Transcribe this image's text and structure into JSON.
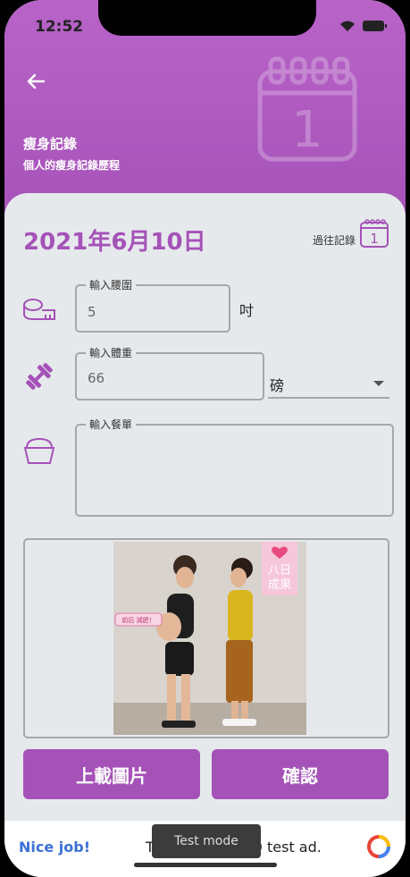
{
  "status": {
    "time": "12:52"
  },
  "header": {
    "title": "瘦身記錄",
    "subtitle": "個人的瘦身記錄歷程",
    "calendar_number": "1"
  },
  "record": {
    "date": "2021年6月10日",
    "history_label": "過往記錄",
    "history_icon_number": "1"
  },
  "waist": {
    "legend": "輸入腰圍",
    "value": "5",
    "unit": "吋"
  },
  "weight": {
    "legend": "輸入體重",
    "value": "66",
    "unit_selected": "磅"
  },
  "meal": {
    "legend": "輸入餐單",
    "value": ""
  },
  "photo": {
    "badge_line1": "八日",
    "badge_line2": "成果",
    "tag": "前后 減肥！"
  },
  "buttons": {
    "upload": "上載圖片",
    "confirm": "確認"
  },
  "ad": {
    "nice": "Nice job!",
    "message": "This is a 320x50 test ad.",
    "mode": "Test mode"
  },
  "colors": {
    "accent": "#a552b8",
    "background": "#e6e9ec",
    "ad_link": "#3a6fd8"
  }
}
